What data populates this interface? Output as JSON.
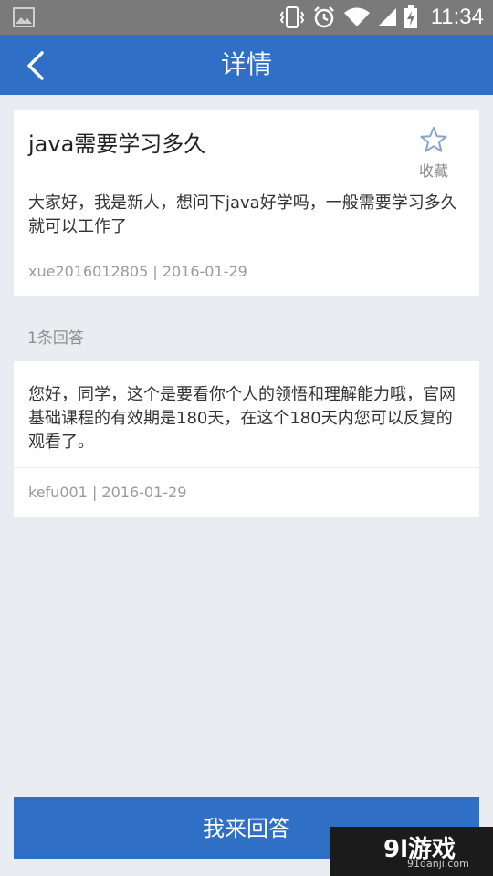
{
  "status_bar": {
    "time": "11:34",
    "icons": [
      "image-icon",
      "vibrate-icon",
      "alarm-icon",
      "wifi-icon",
      "signal-icon",
      "battery-charging-icon"
    ]
  },
  "header": {
    "title": "详情",
    "back_icon": "back-arrow-icon"
  },
  "question": {
    "title": "java需要学习多久",
    "favorite_label": "收藏",
    "body": "大家好，我是新人，想问下java好学吗，一般需要学习多久就可以工作了",
    "meta": "xue2016012805 | 2016-01-29"
  },
  "answers": {
    "count_label": "1条回答",
    "items": [
      {
        "body": "您好，同学，这个是要看你个人的领悟和理解能力哦，官网基础课程的有效期是180天，在这个180天内您可以反复的观看了。",
        "meta": "kefu001 | 2016-01-29"
      }
    ]
  },
  "footer": {
    "answer_button": "我来回答"
  },
  "watermark": {
    "logo": "9l游戏",
    "sub": "91danji.com"
  },
  "colors": {
    "primary": "#2f6fc5",
    "background": "#e9edf2",
    "status_bar": "#7a7a7a"
  }
}
